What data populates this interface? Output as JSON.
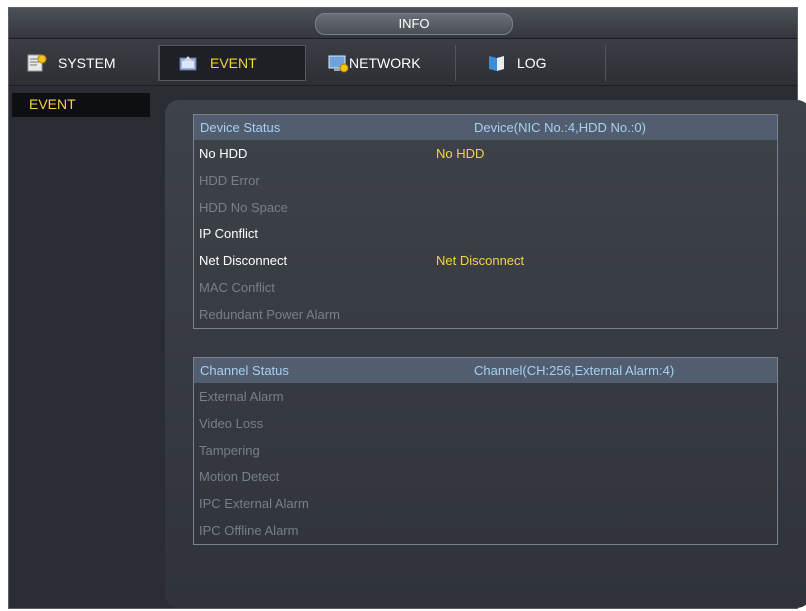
{
  "title": "INFO",
  "tabs": [
    {
      "label": "SYSTEM",
      "icon": "system-icon",
      "active": false
    },
    {
      "label": "EVENT",
      "icon": "event-icon",
      "active": true
    },
    {
      "label": "NETWORK",
      "icon": "network-icon",
      "active": false
    },
    {
      "label": "LOG",
      "icon": "log-icon",
      "active": false
    }
  ],
  "sidebar": {
    "items": [
      {
        "label": "EVENT",
        "selected": true
      }
    ]
  },
  "device_status": {
    "header": "Device Status",
    "summary": "Device(NIC No.:4,HDD No.:0)",
    "rows": [
      {
        "name": "No HDD",
        "value": "No HDD",
        "active": true
      },
      {
        "name": "HDD Error",
        "value": "",
        "active": false
      },
      {
        "name": "HDD No Space",
        "value": "",
        "active": false
      },
      {
        "name": "IP Conflict",
        "value": "",
        "active": true
      },
      {
        "name": "Net Disconnect",
        "value": "Net Disconnect",
        "active": true
      },
      {
        "name": "MAC Conflict",
        "value": "",
        "active": false
      },
      {
        "name": "Redundant Power Alarm",
        "value": "",
        "active": false
      }
    ]
  },
  "channel_status": {
    "header": "Channel Status",
    "summary": "Channel(CH:256,External Alarm:4)",
    "rows": [
      {
        "name": "External Alarm",
        "value": "",
        "active": false
      },
      {
        "name": "Video Loss",
        "value": "",
        "active": false
      },
      {
        "name": "Tampering",
        "value": "",
        "active": false
      },
      {
        "name": "Motion Detect",
        "value": "",
        "active": false
      },
      {
        "name": "IPC External Alarm",
        "value": "",
        "active": false
      },
      {
        "name": "IPC Offline Alarm",
        "value": "",
        "active": false
      }
    ]
  },
  "colors": {
    "accent": "#f5d53c",
    "header_text": "#a7d0f2",
    "dim_text": "#7a7e85",
    "active_text": "#ffffff"
  }
}
